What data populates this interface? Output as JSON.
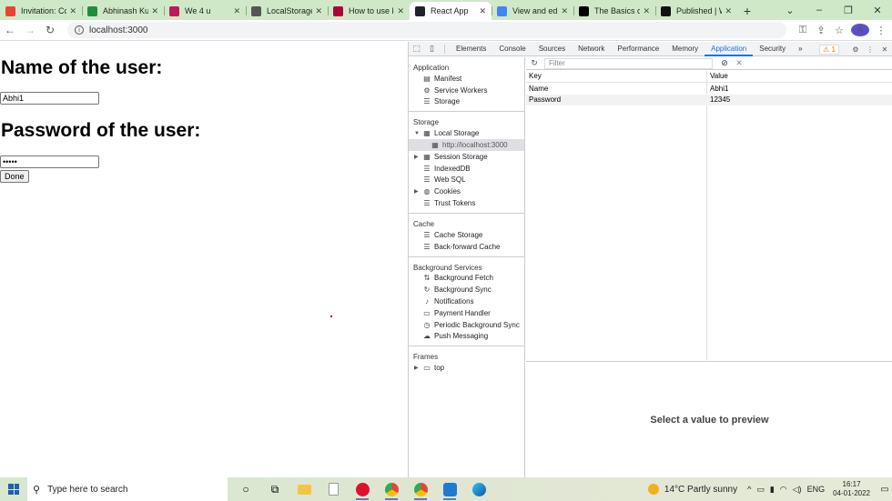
{
  "browser": {
    "tabs": [
      {
        "title": "Invitation: Co",
        "color": "#ea4335"
      },
      {
        "title": "Abhinash Kum",
        "color": "#1e8e3e"
      },
      {
        "title": "We 4 u",
        "color": "#c2185b"
      },
      {
        "title": "LocalStorage i",
        "color": "#555555"
      },
      {
        "title": "How to use lo",
        "color": "#b0003a"
      },
      {
        "title": "React App",
        "color": "#20232a",
        "active": true
      },
      {
        "title": "View and edit",
        "color": "#4285f4"
      },
      {
        "title": "The Basics of",
        "color": "#000000"
      },
      {
        "title": "Published | W",
        "color": "#111111"
      }
    ],
    "new_tab_label": "+",
    "address": "localhost:3000"
  },
  "page": {
    "name_heading": "Name of the user:",
    "name_value": "Abhi1",
    "password_heading": "Password of the user:",
    "password_value": "•••••",
    "done_label": "Done"
  },
  "devtools": {
    "tabs": [
      "Elements",
      "Console",
      "Sources",
      "Network",
      "Performance",
      "Memory",
      "Application",
      "Security"
    ],
    "active_tab": "Application",
    "more_label": "»",
    "warning_count": "1",
    "sidebar": {
      "application": {
        "title": "Application",
        "items": [
          "Manifest",
          "Service Workers",
          "Storage"
        ]
      },
      "storage": {
        "title": "Storage",
        "local_storage": "Local Storage",
        "origin": "http://localhost:3000",
        "items": [
          "Session Storage",
          "IndexedDB",
          "Web SQL",
          "Cookies",
          "Trust Tokens"
        ]
      },
      "cache": {
        "title": "Cache",
        "items": [
          "Cache Storage",
          "Back-forward Cache"
        ]
      },
      "background": {
        "title": "Background Services",
        "items": [
          "Background Fetch",
          "Background Sync",
          "Notifications",
          "Payment Handler",
          "Periodic Background Sync",
          "Push Messaging"
        ]
      },
      "frames": {
        "title": "Frames",
        "items": [
          "top"
        ]
      }
    },
    "filter_placeholder": "Filter",
    "table": {
      "headers": [
        "Key",
        "Value"
      ],
      "rows": [
        {
          "key": "Name",
          "value": "Abhi1"
        },
        {
          "key": "Password",
          "value": "12345"
        }
      ]
    },
    "preview_text": "Select a value to preview"
  },
  "taskbar": {
    "search_placeholder": "Type here to search",
    "weather": "14°C  Partly sunny",
    "language": "ENG",
    "time": "16:17",
    "date": "04-01-2022"
  }
}
